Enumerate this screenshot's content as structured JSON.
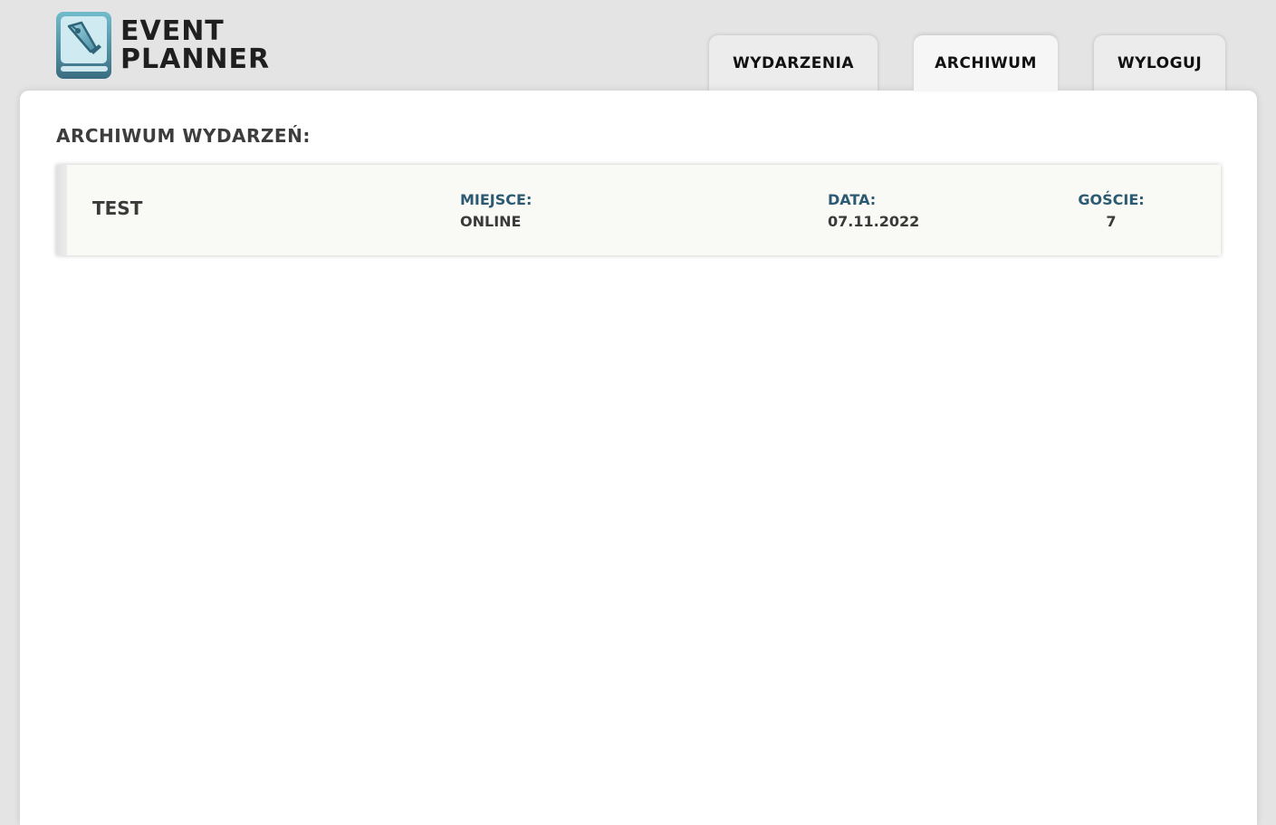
{
  "app": {
    "logo_line1": "Event",
    "logo_line2": "Planner"
  },
  "nav": {
    "tabs": [
      {
        "label": "Wydarzenia",
        "active": false
      },
      {
        "label": "Archiwum",
        "active": true
      },
      {
        "label": "Wyloguj",
        "active": false
      }
    ]
  },
  "main": {
    "title": "Archiwum wydarzeń:",
    "events": [
      {
        "name": "Test",
        "place_label": "Miejsce:",
        "place": "Online",
        "date_label": "Data:",
        "date": "07.11.2022",
        "guests_label": "Goście:",
        "guests": "7"
      }
    ]
  },
  "colors": {
    "background": "#e4e4e4",
    "panel": "#ffffff",
    "card": "#f9f9f6",
    "label_accent": "#2c5a72",
    "text_dark": "#3a3a3a",
    "logo_gradient_top": "#6bb7c8",
    "logo_gradient_bottom": "#3b6f84"
  }
}
